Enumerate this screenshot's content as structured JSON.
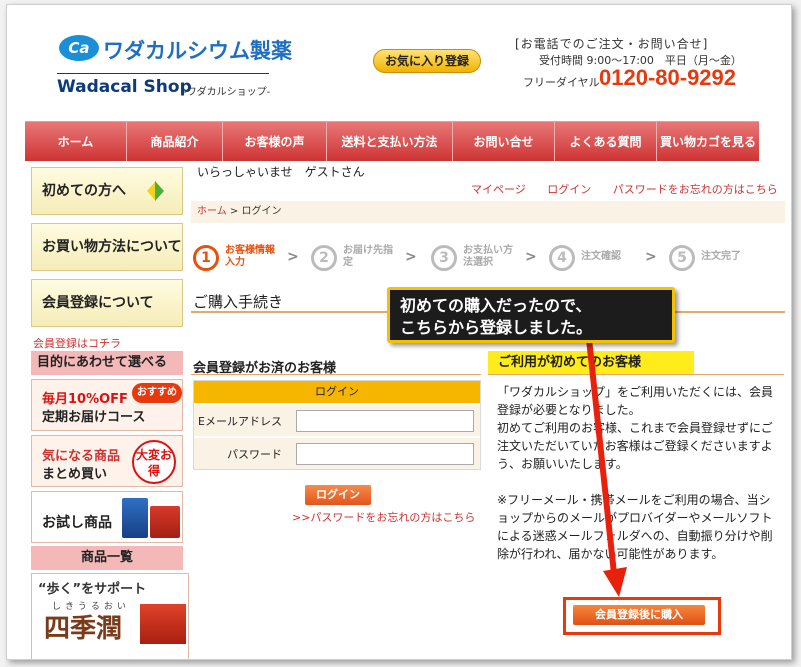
{
  "header": {
    "logo_badge": "Ca",
    "logo_jp": "ワダカルシウム製薬",
    "logo_en": "Wadacal Shop",
    "logo_en_sub": "-ワダカルショップ-",
    "favorite_button": "お気に入り登録",
    "tel_heading": "[お電話でのご注文・お問い合せ]",
    "tel_hours": "受付時間 9:00～17:00　平日（月～金）",
    "tel_free_label": "フリーダイヤル",
    "tel_number": "0120-80-9292"
  },
  "nav": {
    "items": [
      {
        "label": "ホーム"
      },
      {
        "label": "商品紹介"
      },
      {
        "label": "お客様の声"
      },
      {
        "label": "送料と支払い方法"
      },
      {
        "label": "お問い合せ"
      },
      {
        "label": "よくある質問"
      },
      {
        "label": "買い物カゴを見る"
      }
    ]
  },
  "sidebar": {
    "first_time": "初めての方へ",
    "how_to_buy": "お買い物方法について",
    "member_reg": "会員登録について",
    "member_link": "会員登録はコチラ",
    "purpose_head": "目的にあわせて選べる",
    "card1_line1": "毎月10%OFF",
    "card1_line2": "定期お届けコース",
    "card1_badge": "おすすめ",
    "card2_line1": "気になる商品",
    "card2_line2": "まとめ買い",
    "card2_badge": "大変お得",
    "card3": "お試し商品",
    "product_list": "商品一覧",
    "promo_title": "“歩く”をサポート",
    "promo_ruby": "しきうるおい",
    "promo_main": "四季潤"
  },
  "main": {
    "welcome": "いらっしゃいませ　ゲストさん",
    "links": {
      "mypage": "マイページ",
      "login": "ログイン",
      "forgot": "パスワードをお忘れの方はこちら"
    },
    "breadcrumb": {
      "home": "ホーム",
      "sep": " > ",
      "current": "ログイン"
    },
    "steps": [
      {
        "num": "1",
        "label": "お客様情報入力"
      },
      {
        "num": "2",
        "label": "お届け先指定"
      },
      {
        "num": "3",
        "label": "お支払い方法選択"
      },
      {
        "num": "4",
        "label": "注文確認"
      },
      {
        "num": "5",
        "label": "注文完了"
      }
    ],
    "step_arrow": ">",
    "section_title": "ご購入手続き",
    "callout_line1": "初めての購入だったので、",
    "callout_line2": "こちらから登録しました。",
    "members": {
      "heading": "会員登録がお済のお客様",
      "table_head": "ログイン",
      "email_label": "Eメールアドレス",
      "password_label": "パスワード",
      "email_value": "",
      "password_value": "",
      "login_button": "ログイン",
      "forgot_link": ">>パスワードをお忘れの方はこちら"
    },
    "new_customer": {
      "heading": "ご利用が初めてのお客様",
      "p1": "「ワダカルショップ」をご利用いただくには、会員登録が必要となりました。",
      "p2": "初めてご利用のお客様、これまで会員登録せずにご注文いただいていたお客様はご登録くださいますよう、お願いいたします。",
      "p3": "※フリーメール・携帯メールをご利用の場合、当ショップからのメールがプロバイダーやメールソフトによる迷惑メールフォルダへの、自動振り分けや削除が行われ、届かない可能性があります。",
      "register_button": "会員登録後に購入"
    }
  },
  "colors": {
    "nav_red": "#d94545",
    "accent_orange": "#e8380d",
    "callout_border": "#f2c100",
    "new_head_yellow": "#ffec1a"
  }
}
